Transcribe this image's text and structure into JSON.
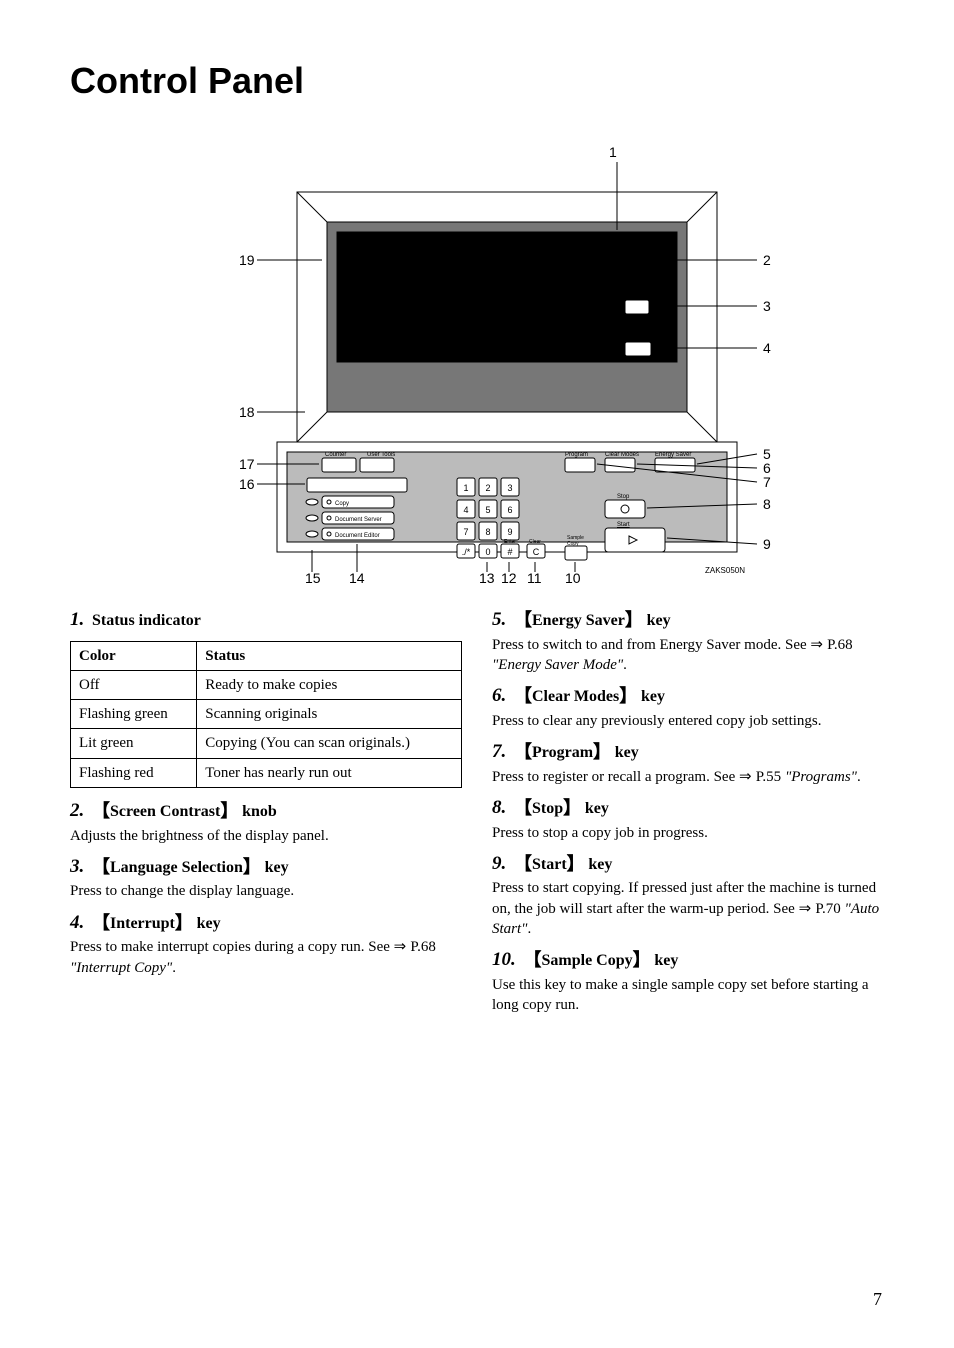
{
  "title": "Control Panel",
  "callouts": {
    "1": "1",
    "2": "2",
    "3": "3",
    "4": "4",
    "5": "5",
    "6": "6",
    "7": "7",
    "8": "8",
    "9": "9",
    "10": "10",
    "11": "11",
    "12": "12",
    "13": "13",
    "14": "14",
    "15": "15",
    "16": "16",
    "17": "17",
    "18": "18",
    "19": "19"
  },
  "diagram_ref": "ZAKS050N",
  "left": {
    "i1": {
      "num": "1.",
      "label": "Status indicator"
    },
    "table": {
      "h1": "Color",
      "h2": "Status",
      "rows": [
        {
          "c1": "Off",
          "c2": "Ready to make copies"
        },
        {
          "c1": "Flashing green",
          "c2": "Scanning originals"
        },
        {
          "c1": "Lit green",
          "c2": "Copying (You can scan originals.)"
        },
        {
          "c1": "Flashing red",
          "c2": "Toner has nearly run out"
        }
      ]
    },
    "i2": {
      "num": "2.",
      "label": "Screen Contrast",
      "suffix": "knob",
      "desc": "Adjusts the brightness of the display panel."
    },
    "i3": {
      "num": "3.",
      "label": "Language Selection",
      "suffix": "key",
      "desc": "Press to change the display language."
    },
    "i4": {
      "num": "4.",
      "label": "Interrupt",
      "suffix": "key",
      "desc_a": "Press to make interrupt copies during a copy run. See ",
      "desc_b": "P.68 ",
      "desc_c": "\"Interrupt Copy\"",
      "desc_d": "."
    }
  },
  "right": {
    "i5": {
      "num": "5.",
      "label": "Energy Saver",
      "suffix": "key",
      "desc_a": "Press to switch to and from Energy Saver mode. See ",
      "desc_b": "P.68 ",
      "desc_c": "\"Energy Saver Mode\"",
      "desc_d": "."
    },
    "i6": {
      "num": "6.",
      "label": "Clear Modes",
      "suffix": "key",
      "desc": "Press to clear any previously entered copy job settings."
    },
    "i7": {
      "num": "7.",
      "label": "Program",
      "suffix": "key",
      "desc_a": "Press to register or recall a program. See ",
      "desc_b": "P.55 ",
      "desc_c": "\"Programs\"",
      "desc_d": "."
    },
    "i8": {
      "num": "8.",
      "label": "Stop",
      "suffix": "key",
      "desc": "Press to stop a copy job in progress."
    },
    "i9": {
      "num": "9.",
      "label": "Start",
      "suffix": "key",
      "desc_a": "Press to start copying. If pressed just after the machine is turned on, the job will start after the warm-up period. See ",
      "desc_b": "P.70 ",
      "desc_c": "\"Auto Start\"",
      "desc_d": "."
    },
    "i10": {
      "num": "10.",
      "label": "Sample Copy",
      "suffix": "key",
      "desc": "Use this key to make a single sample copy set before starting a long copy run."
    }
  },
  "pagenum": "7"
}
